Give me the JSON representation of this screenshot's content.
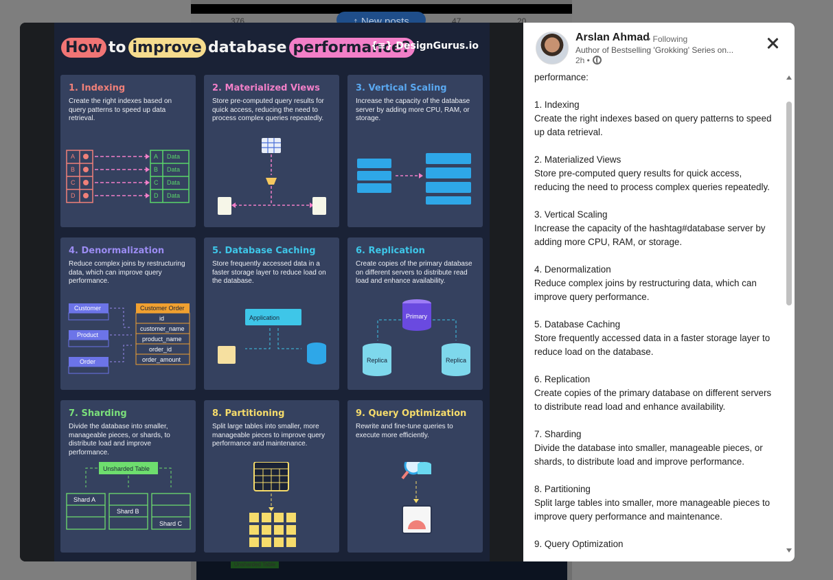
{
  "background_feed": {
    "reaction_count": "376",
    "comments_hint": "47",
    "reposts_hint": "20",
    "new_posts_label": "New posts",
    "bottom_hint": "Unsharded Table"
  },
  "infographic": {
    "title_parts": [
      "How",
      "to",
      "improve",
      "database",
      "performance?"
    ],
    "brand": "{≡} DesignGurus.io",
    "cards": [
      {
        "title": "1. Indexing",
        "color": "#f08079",
        "desc": "Create the right indexes based on query patterns to speed up data retrieval."
      },
      {
        "title": "2. Materialized Views",
        "color": "#f27fc8",
        "desc": "Store pre-computed query results for quick access, reducing the need to process complex queries repeatedly."
      },
      {
        "title": "3. Vertical Scaling",
        "color": "#5aa8f0",
        "desc": "Increase the capacity of the database server by adding more CPU, RAM, or storage."
      },
      {
        "title": "4. Denormalization",
        "color": "#9b8cf2",
        "desc": "Reduce complex joins by restructuring data, which can improve query performance."
      },
      {
        "title": "5. Database Caching",
        "color": "#3ec6e8",
        "desc": "Store frequently accessed data in a faster storage layer to reduce load on the database."
      },
      {
        "title": "6. Replication",
        "color": "#3ec6e8",
        "desc": "Create copies of the primary database on different servers to distribute read load and enhance availability."
      },
      {
        "title": "7. Sharding",
        "color": "#7be07b",
        "desc": "Divide the database into smaller, manageable pieces, or shards, to distribute load and improve performance."
      },
      {
        "title": "8. Partitioning",
        "color": "#f6dc6b",
        "desc": "Split large tables into smaller, more manageable pieces to improve query performance and maintenance."
      },
      {
        "title": "9. Query Optimization",
        "color": "#f6dc6b",
        "desc": "Rewrite and fine-tune queries to execute more efficiently."
      }
    ],
    "diagram_labels": {
      "index_rows": [
        "A",
        "B",
        "C",
        "D"
      ],
      "data": "Data",
      "customer": "Customer",
      "product": "Product",
      "order": "Order",
      "customer_order": "Customer Order",
      "order_fields": [
        "id",
        "customer_name",
        "product_name",
        "order_id",
        "order_amount"
      ],
      "application": "Application",
      "primary": "Primary",
      "replica": "Replica",
      "unsharded_table": "Unsharded Table",
      "shards": [
        "Shard A",
        "Shard B",
        "Shard C"
      ]
    }
  },
  "post": {
    "author": "Arslan Ahmad",
    "follow_status": "• Following",
    "headline": "Author of Bestselling 'Grokking' Series on...",
    "time": "2h •",
    "paragraphs": [
      [
        "performance:"
      ],
      [
        "1. Indexing",
        "Create the right indexes based on query patterns to speed up data retrieval."
      ],
      [
        "2. Materialized Views",
        "Store pre-computed query results for quick access, reducing the need to process complex queries repeatedly."
      ],
      [
        "3. Vertical Scaling",
        "Increase the capacity of the hashtag#database server by adding more CPU, RAM, or storage."
      ],
      [
        "4. Denormalization",
        "Reduce complex joins by restructuring data, which can improve query performance."
      ],
      [
        "5. Database Caching",
        "Store frequently accessed data in a faster storage layer to reduce load on the database."
      ],
      [
        "6. Replication",
        "Create copies of the primary database on different servers to distribute read load and enhance availability."
      ],
      [
        "7. Sharding",
        "Divide the database into smaller, manageable pieces, or shards, to distribute load and improve performance."
      ],
      [
        "8. Partitioning",
        "Split large tables into smaller, more manageable pieces to improve query performance and maintenance."
      ],
      [
        "9. Query Optimization"
      ]
    ]
  }
}
